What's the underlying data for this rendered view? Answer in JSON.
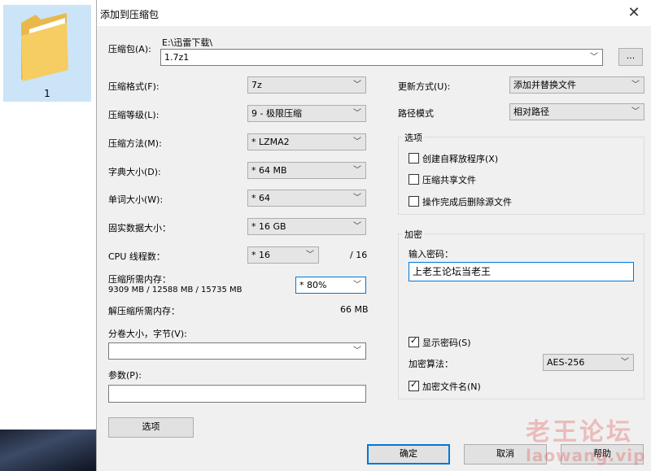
{
  "desktop": {
    "icon_label": "1"
  },
  "dialog": {
    "title": "添加到压缩包",
    "archive_label": "压缩包(A):",
    "archive_path": "E:\\迅雷下载\\",
    "archive_name": "1.7z1",
    "browse_label": "...",
    "left": [
      {
        "label": "压缩格式(F):",
        "value": "7z"
      },
      {
        "label": "压缩等级(L):",
        "value": "9 - 极限压缩"
      },
      {
        "label": "压缩方法(M):",
        "value": "* LZMA2"
      },
      {
        "label": "字典大小(D):",
        "value": "* 64 MB"
      },
      {
        "label": "单词大小(W):",
        "value": "* 64"
      },
      {
        "label": "固实数据大小：",
        "value": "* 16 GB"
      }
    ],
    "cpu": {
      "label": "CPU 线程数：",
      "value": "* 16",
      "total": "/ 16"
    },
    "mem_compress": {
      "label": "压缩所需内存：",
      "detail": "9309 MB / 12588 MB / 15735 MB",
      "value": "* 80%"
    },
    "mem_decompress": {
      "label": "解压缩所需内存：",
      "value": "66 MB"
    },
    "volume": {
      "label": "分卷大小，字节(V):",
      "value": ""
    },
    "params": {
      "label": "参数(P):",
      "value": ""
    },
    "options_button": "选项",
    "update_mode": {
      "label": "更新方式(U):",
      "value": "添加并替换文件"
    },
    "path_mode": {
      "label": "路径模式",
      "value": "相对路径"
    },
    "options_group": {
      "title": "选项",
      "items": [
        {
          "label": "创建自释放程序(X)",
          "checked": false
        },
        {
          "label": "压缩共享文件",
          "checked": false
        },
        {
          "label": "操作完成后删除源文件",
          "checked": false
        }
      ]
    },
    "encryption_group": {
      "title": "加密",
      "password_label": "输入密码：",
      "password_value": "上老王论坛当老王",
      "show_password": "显示密码(S)",
      "method_label": "加密算法：",
      "method_value": "AES-256",
      "encrypt_names": "加密文件名(N)"
    },
    "buttons": {
      "ok": "确定",
      "cancel": "取消",
      "help": "帮助"
    }
  },
  "watermark": {
    "line1": "老王论坛",
    "line2": "laowang.vip"
  }
}
